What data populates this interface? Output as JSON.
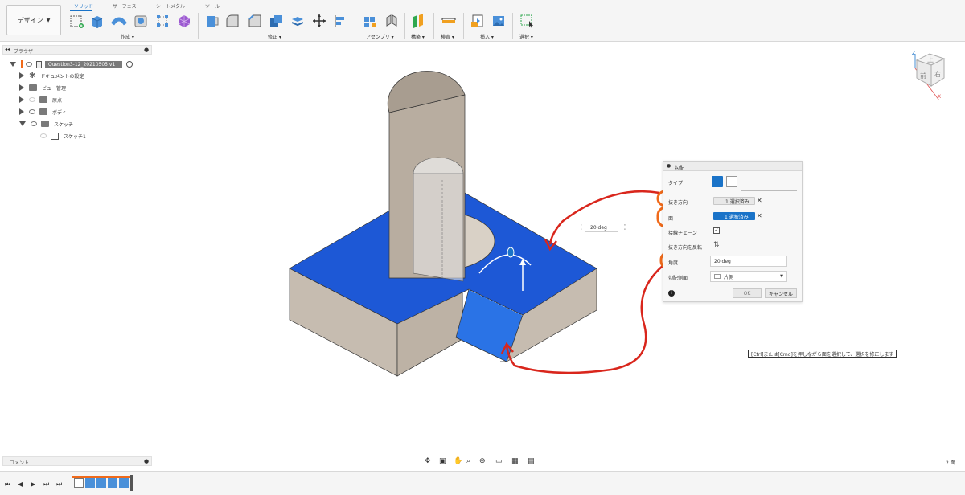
{
  "toolbar": {
    "design_label": "デザイン",
    "tabs": [
      "ソリッド",
      "サーフェス",
      "シートメタル",
      "ツール"
    ],
    "groups": {
      "create": "作成",
      "modify": "修正",
      "assemble": "アセンブリ",
      "construct": "構築",
      "inspect": "検査",
      "insert": "挿入",
      "select": "選択"
    }
  },
  "browser": {
    "title": "ブラウザ",
    "items": [
      {
        "label": "Question3-12_20210505 v1"
      },
      {
        "label": "ドキュメントの設定"
      },
      {
        "label": "ビュー管理"
      },
      {
        "label": "原点"
      },
      {
        "label": "ボディ"
      },
      {
        "label": "スケッチ"
      },
      {
        "label": "スケッチ1"
      }
    ]
  },
  "viewcube": {
    "front": "前",
    "right": "右",
    "top": "上",
    "axis_z": "Z",
    "axis_x": "X"
  },
  "dialog": {
    "title": "勾配",
    "type_label": "タイプ",
    "pull_direction_label": "抜き方向",
    "pull_direction_value": "1 選択済み",
    "faces_label": "面",
    "faces_value": "1 選択済み",
    "tangent_chain_label": "接線チェーン",
    "flip_label": "抜き方向を反転",
    "angle_label": "角度",
    "angle_value": "20 deg",
    "draft_side_label": "勾配側面",
    "draft_side_value": "片側",
    "ok_label": "OK",
    "cancel_label": "キャンセル"
  },
  "canvas": {
    "angle_float": "20 deg",
    "tooltip": "[Ctrl]または[Cmd]を押しながら面を選択して、選択を修正します"
  },
  "bottom": {
    "comments_label": "コメント",
    "face_count": "2 面"
  },
  "colors": {
    "accent": "#1a73c8",
    "selection_blue": "#1f5bd6",
    "annotation_orange": "#f06a1a",
    "annotation_red": "#d9261c"
  }
}
